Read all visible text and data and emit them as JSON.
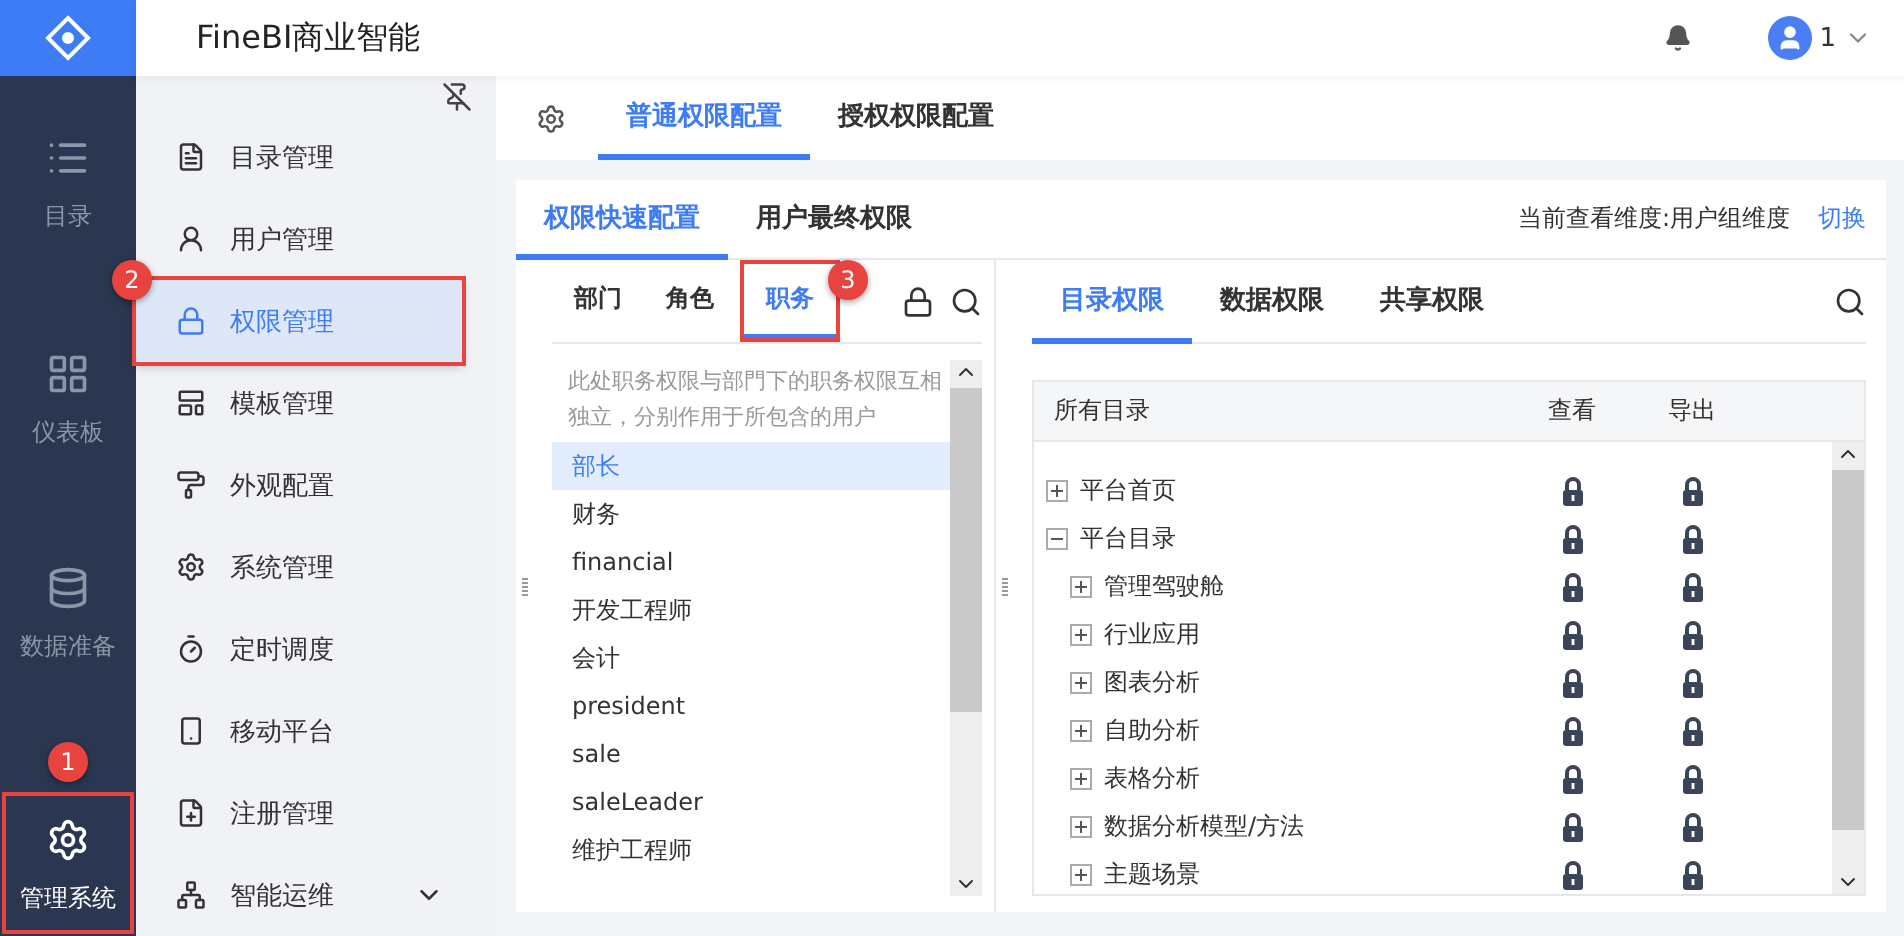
{
  "app": {
    "title": "FineBI商业智能",
    "user": "1"
  },
  "rail": [
    {
      "kind": "list",
      "label": "目录",
      "selected": false,
      "highlighted": false
    },
    {
      "kind": "grid",
      "label": "仪表板",
      "selected": false,
      "highlighted": false
    },
    {
      "kind": "database",
      "label": "数据准备",
      "selected": false,
      "highlighted": false
    },
    {
      "kind": "gear",
      "label": "管理系统",
      "selected": true,
      "highlighted": true,
      "badge": "1"
    }
  ],
  "menu": [
    {
      "kind": "catalog",
      "label": "目录管理",
      "selected": false,
      "highlighted": false
    },
    {
      "kind": "user",
      "label": "用户管理",
      "selected": false,
      "highlighted": false
    },
    {
      "kind": "lock",
      "label": "权限管理",
      "selected": true,
      "highlighted": true,
      "badge": "2"
    },
    {
      "kind": "template",
      "label": "模板管理",
      "selected": false,
      "highlighted": false
    },
    {
      "kind": "paint",
      "label": "外观配置",
      "selected": false,
      "highlighted": false
    },
    {
      "kind": "gear",
      "label": "系统管理",
      "selected": false,
      "highlighted": false
    },
    {
      "kind": "timer",
      "label": "定时调度",
      "selected": false,
      "highlighted": false
    },
    {
      "kind": "phone",
      "label": "移动平台",
      "selected": false,
      "highlighted": false
    },
    {
      "kind": "register",
      "label": "注册管理",
      "selected": false,
      "highlighted": false
    },
    {
      "kind": "ops",
      "label": "智能运维",
      "selected": false,
      "highlighted": false,
      "expandable": true
    }
  ],
  "top_tabs": [
    {
      "label": "普通权限配置",
      "selected": true
    },
    {
      "label": "授权权限配置",
      "selected": false
    }
  ],
  "sub_tabs": [
    {
      "label": "权限快速配置",
      "selected": true
    },
    {
      "label": "用户最终权限",
      "selected": false
    }
  ],
  "dimension": {
    "text": "当前查看维度:用户组维度",
    "link": "切换"
  },
  "group_tabs": [
    {
      "label": "部门",
      "selected": false,
      "highlighted": false
    },
    {
      "label": "角色",
      "selected": false,
      "highlighted": false
    },
    {
      "label": "职务",
      "selected": true,
      "highlighted": true,
      "badge": "3"
    }
  ],
  "note": "此处职务权限与部門下的职务权限互相独立，分别作用于所包含的用户",
  "positions": [
    {
      "label": "部长",
      "selected": true
    },
    {
      "label": "财务",
      "selected": false
    },
    {
      "label": "financial",
      "selected": false
    },
    {
      "label": "开发工程师",
      "selected": false
    },
    {
      "label": "会计",
      "selected": false
    },
    {
      "label": "president",
      "selected": false
    },
    {
      "label": "sale",
      "selected": false
    },
    {
      "label": "saleLeader",
      "selected": false
    },
    {
      "label": "维护工程师",
      "selected": false
    }
  ],
  "perm_tabs": [
    {
      "label": "目录权限",
      "selected": true
    },
    {
      "label": "数据权限",
      "selected": false
    },
    {
      "label": "共享权限",
      "selected": false
    }
  ],
  "table": {
    "columns": [
      "所有目录",
      "查看",
      "导出"
    ],
    "rows": [
      {
        "label": "平台首页",
        "expanded": false,
        "view_locked": true,
        "export_locked": true
      },
      {
        "label": "平台目录",
        "expanded": true,
        "view_locked": true,
        "export_locked": true,
        "children": [
          {
            "label": "管理驾驶舱",
            "expanded": false,
            "view_locked": true,
            "export_locked": true
          },
          {
            "label": "行业应用",
            "expanded": false,
            "view_locked": true,
            "export_locked": true
          },
          {
            "label": "图表分析",
            "expanded": false,
            "view_locked": true,
            "export_locked": true
          },
          {
            "label": "自助分析",
            "expanded": false,
            "view_locked": true,
            "export_locked": true
          },
          {
            "label": "表格分析",
            "expanded": false,
            "view_locked": true,
            "export_locked": true
          },
          {
            "label": "数据分析模型/方法",
            "expanded": false,
            "view_locked": true,
            "export_locked": true
          },
          {
            "label": "主题场景",
            "expanded": false,
            "view_locked": true,
            "export_locked": true
          }
        ]
      }
    ]
  }
}
